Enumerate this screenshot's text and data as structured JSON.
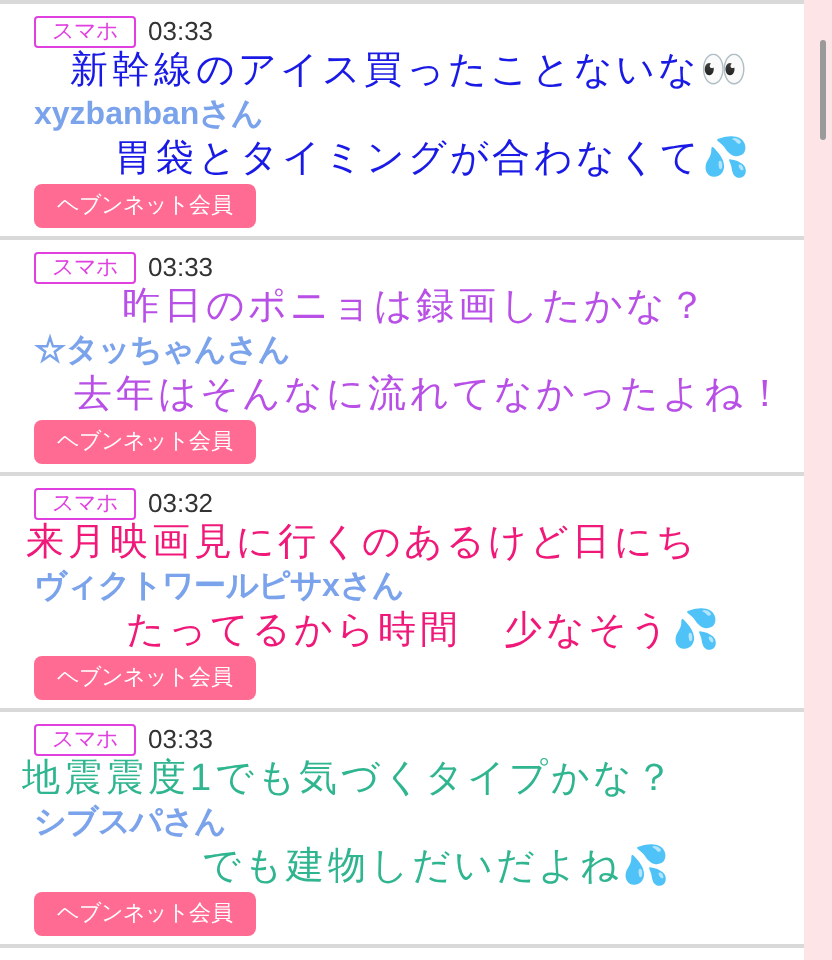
{
  "posts": [
    {
      "tag": "スマホ",
      "time": "03:33",
      "name": "xyzbanbanさん",
      "badge": "ヘブンネット会員",
      "caption": {
        "color": "#1a1ae6",
        "lines": [
          "新幹線のアイス買ったことないな👀",
          "胃袋とタイミングが合わなくて💦"
        ]
      }
    },
    {
      "tag": "スマホ",
      "time": "03:33",
      "name": "☆タッちゃんさん",
      "badge": "ヘブンネット会員",
      "caption": {
        "color": "#b84fe6",
        "lines": [
          "昨日のポニョは録画したかな？",
          "去年はそんなに流れてなかったよね！"
        ]
      }
    },
    {
      "tag": "スマホ",
      "time": "03:32",
      "name": "ヴィクトワールピサxさん",
      "badge": "ヘブンネット会員",
      "caption": {
        "color": "#f01878",
        "lines": [
          "来月映画見に行くのあるけど日にち",
          "たってるから時間　少なそう💦"
        ]
      }
    },
    {
      "tag": "スマホ",
      "time": "03:33",
      "name": "シブスパさん",
      "badge": "ヘブンネット会員",
      "caption": {
        "color": "#2fb58f",
        "lines": [
          "地震震度1でも気づくタイプかな？",
          "でも建物しだいだよね💦"
        ]
      }
    }
  ]
}
